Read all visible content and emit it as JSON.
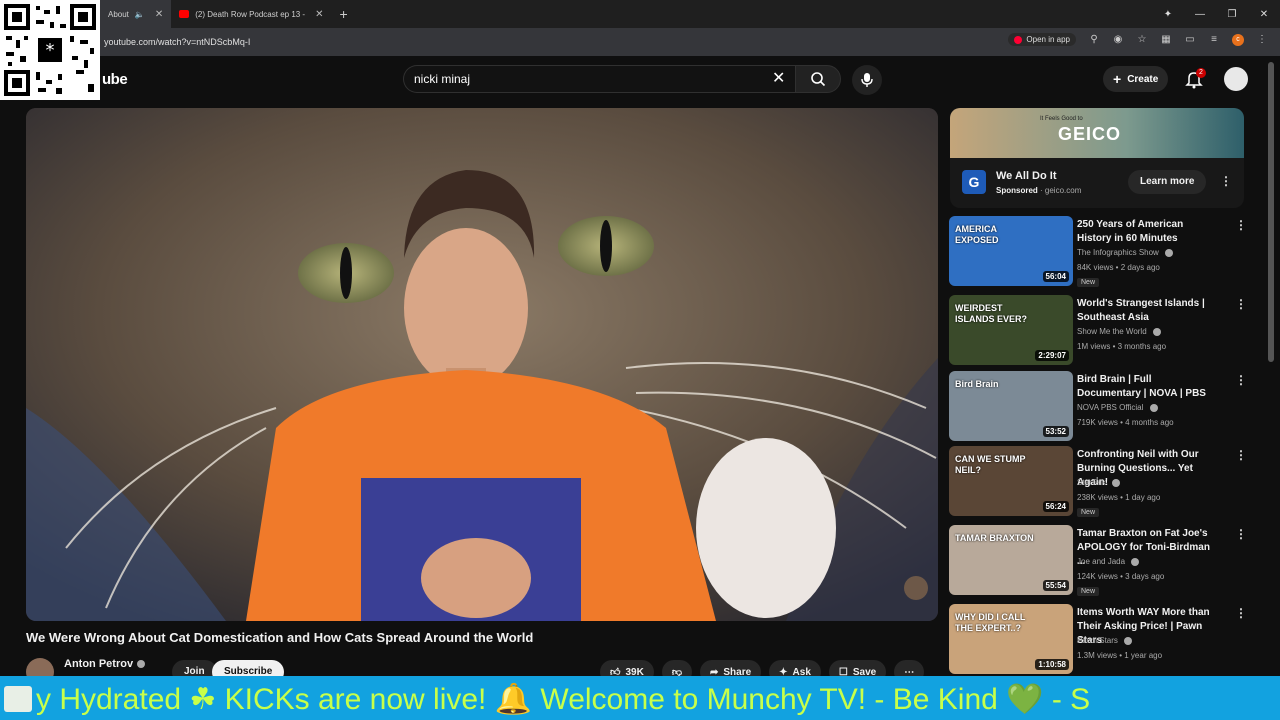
{
  "browser": {
    "tabs": [
      {
        "title": "About",
        "active": true
      },
      {
        "title": "(2) Death Row Podcast ep 13 -",
        "active": false
      }
    ],
    "url": "youtube.com/watch?v=ntNDScbMq-I",
    "open_in_app": "Open in app",
    "profile_initial": "c"
  },
  "header": {
    "logo_text": "ube",
    "search_value": "nicki minaj",
    "create_label": "Create",
    "notif_count": "2"
  },
  "video": {
    "title": "We Were Wrong About Cat Domestication and How Cats Spread Around the World",
    "channel": "Anton Petrov",
    "join_label": "Join",
    "subscribe_label": "Subscribe",
    "likes": "39K",
    "share_label": "Share",
    "ask_label": "Ask",
    "save_label": "Save"
  },
  "ad": {
    "banner_tag": "It Feels Good to",
    "banner_brand": "GEICO",
    "logo_letter": "G",
    "title": "We All Do It",
    "sponsored": "Sponsored",
    "domain": "· geico.com",
    "cta": "Learn more"
  },
  "recommendations": [
    {
      "title": "250 Years of American History in 60 Minutes",
      "channel": "The Infographics Show",
      "meta": "84K views • 2 days ago",
      "duration": "56:04",
      "badge": "New",
      "thumb_text": "AMERICA EXPOSED",
      "thumb_color": "#2f6fc2"
    },
    {
      "title": "World's Strangest Islands | Southeast Asia",
      "channel": "Show Me the World",
      "meta": "1M views • 3 months ago",
      "duration": "2:29:07",
      "badge": "",
      "thumb_text": "WEIRDEST ISLANDS EVER?",
      "thumb_color": "#3a4a2a"
    },
    {
      "title": "Bird Brain | Full Documentary | NOVA | PBS",
      "channel": "NOVA PBS Official",
      "meta": "719K views • 4 months ago",
      "duration": "53:52",
      "badge": "",
      "thumb_text": "Bird Brain",
      "thumb_color": "#7c8a96"
    },
    {
      "title": "Confronting Neil with Our Burning Questions... Yet Again!",
      "channel": "StarTalk",
      "meta": "238K views • 1 day ago",
      "duration": "56:24",
      "badge": "New",
      "thumb_text": "CAN WE STUMP NEIL?",
      "thumb_color": "#5a4636"
    },
    {
      "title": "Tamar Braxton on Fat Joe's APOLOGY for Toni-Birdman ...",
      "channel": "Joe and Jada",
      "meta": "124K views • 3 days ago",
      "duration": "55:54",
      "badge": "New",
      "thumb_text": "TAMAR BRAXTON",
      "thumb_color": "#b8a99a"
    },
    {
      "title": "Items Worth WAY More than Their Asking Price! | Pawn Stars",
      "channel": "Pawn Stars",
      "meta": "1.3M views • 1 year ago",
      "duration": "1:10:58",
      "badge": "",
      "thumb_text": "WHY DID I CALL THE EXPERT..?",
      "thumb_color": "#c9a37a"
    }
  ],
  "ticker": {
    "text": "y Hydrated  ☘ KICKs are now live!  🔔               Welcome to Munchy TV!  - Be Kind  💚  - S"
  }
}
